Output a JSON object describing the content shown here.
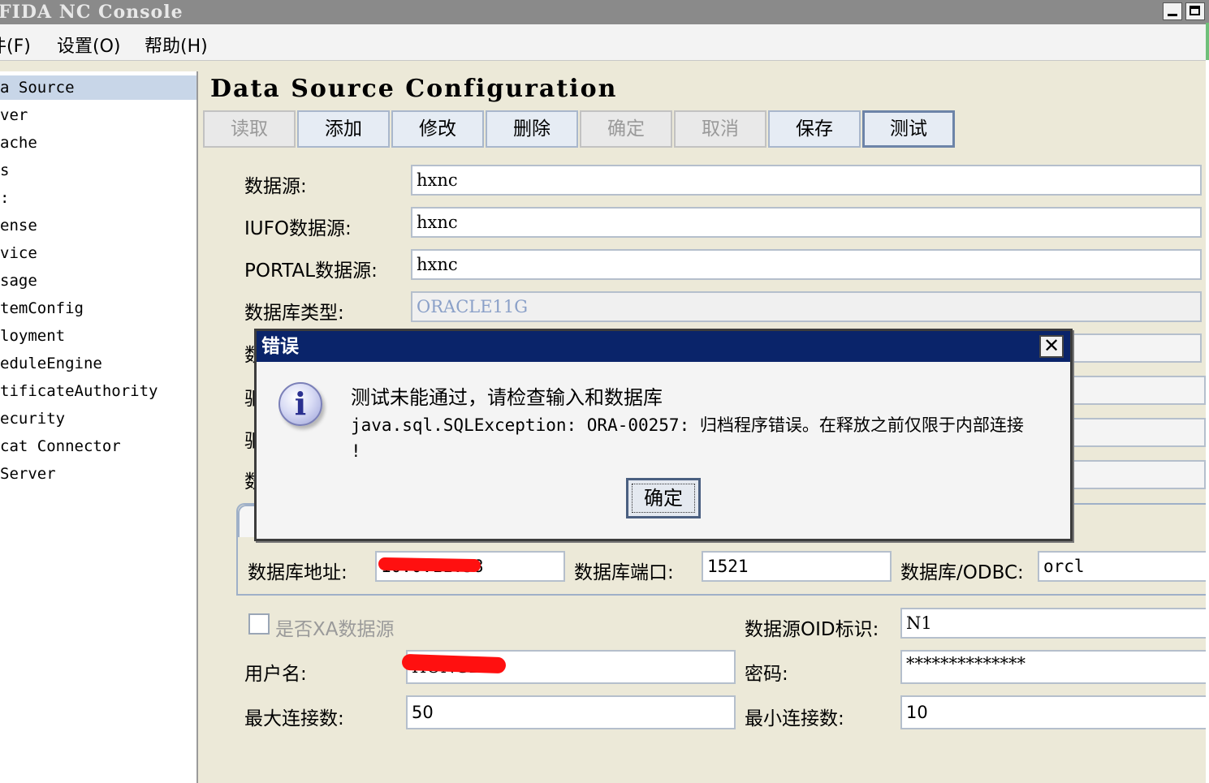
{
  "window": {
    "title": "FIDA NC Console"
  },
  "menu": [
    "件(F)",
    "设置(O)",
    "帮助(H)"
  ],
  "sidebar": {
    "items": [
      {
        "label": "a Source",
        "selected": true
      },
      {
        "label": "ver"
      },
      {
        "label": "ache"
      },
      {
        "label": "s"
      },
      {
        "label": ":"
      },
      {
        "label": "ense"
      },
      {
        "label": "vice"
      },
      {
        "label": "sage"
      },
      {
        "label": "temConfig"
      },
      {
        "label": "loyment"
      },
      {
        "label": "eduleEngine"
      },
      {
        "label": "tificateAuthority"
      },
      {
        "label": "ecurity"
      },
      {
        "label": "cat Connector"
      },
      {
        "label": "Server"
      }
    ]
  },
  "main": {
    "heading": "Data Source Configuration",
    "toolbar": {
      "read": "读取",
      "add": "添加",
      "modify": "修改",
      "delete": "删除",
      "confirm": "确定",
      "cancel": "取消",
      "save": "保存",
      "test": "测试"
    },
    "form": {
      "datasource_label": "数据源:",
      "datasource_value": "hxnc",
      "iufo_label": "IUFO数据源:",
      "iufo_value": "hxnc",
      "portal_label": "PORTAL数据源:",
      "portal_value": "hxnc",
      "dbtype_label": "数据库类型:",
      "dbtype_value": "ORACLE11G",
      "hidden_label_1": "数",
      "hidden_label_2": "驱",
      "hidden_label_3": "驱",
      "hidden_label_4": "数",
      "db_address_label": "数据库地址:",
      "db_address_value": "10.0.11.58",
      "db_port_label": "数据库端口:",
      "db_port_value": "1521",
      "db_odbc_label": "数据库/ODBC:",
      "db_odbc_value": "orcl",
      "xa_label": "是否XA数据源",
      "oid_label": "数据源OID标识:",
      "oid_value": "N1",
      "username_label": "用户名:",
      "username_value": "HONGL",
      "password_label": "密码:",
      "password_value": "**************",
      "max_conn_label": "最大连接数:",
      "max_conn_value": "50",
      "min_conn_label": "最小连接数:",
      "min_conn_value": "10"
    }
  },
  "dialog": {
    "title": "错误",
    "message_line1": "测试未能通过，请检查输入和数据库",
    "message_line2": "java.sql.SQLException: ORA-00257: 归档程序错误。在释放之前仅限于内部连接",
    "message_line3": "!",
    "ok_label": "确定",
    "close_glyph": "✕"
  },
  "colors": {
    "dialog_title_bg": "#0a246a",
    "sidebar_selected": "#c8d6e8",
    "redaction": "#ff1010"
  }
}
